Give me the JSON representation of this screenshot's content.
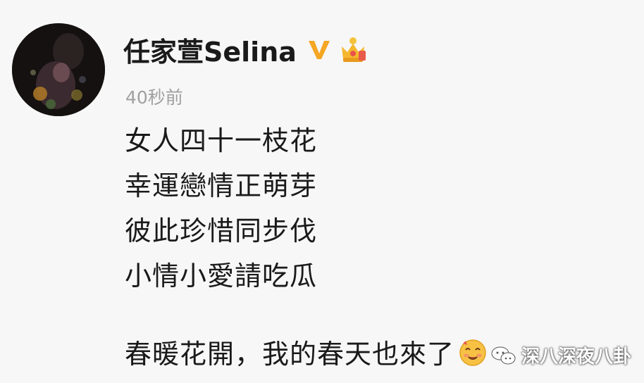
{
  "post": {
    "username": "任家萱Selina",
    "timestamp": "40秒前",
    "lines": [
      "女人四十一枝花",
      "幸運戀情正萌芽",
      "彼此珍惜同步伐",
      "小情小愛請吃瓜"
    ],
    "last_line": "春暖花開，我的春天也來了"
  },
  "icons": {
    "verified": "verified-v-icon",
    "crown": "crown-member-icon",
    "emoji": "smiling-face-emoji-icon",
    "watermark": "wechat-icon"
  },
  "watermark": {
    "text": "深八深夜八卦"
  },
  "colors": {
    "verified": "#f5a623",
    "crown": "#f5b72e",
    "timestamp": "#a0a0a0"
  }
}
